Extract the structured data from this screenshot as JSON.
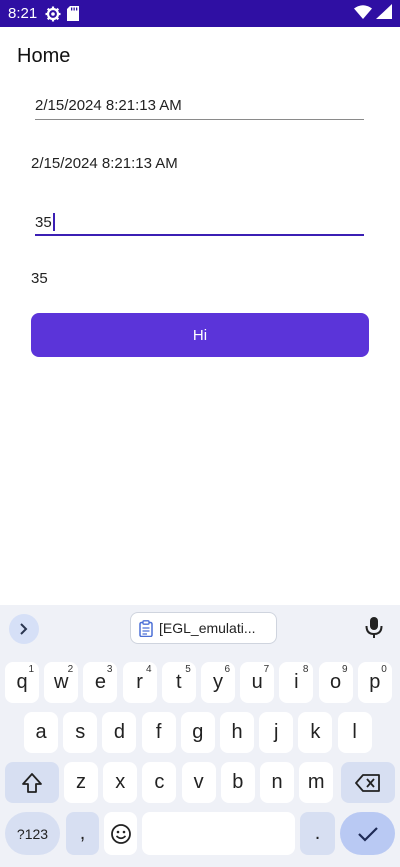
{
  "status_bar": {
    "time": "8:21",
    "left_icons": [
      "settings-icon",
      "sd-card-icon"
    ],
    "right_icons": [
      "wifi-icon",
      "signal-icon"
    ]
  },
  "header": {
    "title": "Home"
  },
  "form": {
    "date_entry_value": "2/15/2024 8:21:13 AM",
    "date_label": "2/15/2024 8:21:13 AM",
    "number_entry_value": "35",
    "number_label": "35",
    "hi_button_label": "Hi"
  },
  "keyboard": {
    "clipboard_chip": "[EGL_emulati...",
    "row1": [
      {
        "k": "q",
        "h": "1"
      },
      {
        "k": "w",
        "h": "2"
      },
      {
        "k": "e",
        "h": "3"
      },
      {
        "k": "r",
        "h": "4"
      },
      {
        "k": "t",
        "h": "5"
      },
      {
        "k": "y",
        "h": "6"
      },
      {
        "k": "u",
        "h": "7"
      },
      {
        "k": "i",
        "h": "8"
      },
      {
        "k": "o",
        "h": "9"
      },
      {
        "k": "p",
        "h": "0"
      }
    ],
    "row2": [
      "a",
      "s",
      "d",
      "f",
      "g",
      "h",
      "j",
      "k",
      "l"
    ],
    "row3": [
      "z",
      "x",
      "c",
      "v",
      "b",
      "n",
      "m"
    ],
    "symbols_key": "?123",
    "comma_key": ",",
    "period_key": "."
  }
}
